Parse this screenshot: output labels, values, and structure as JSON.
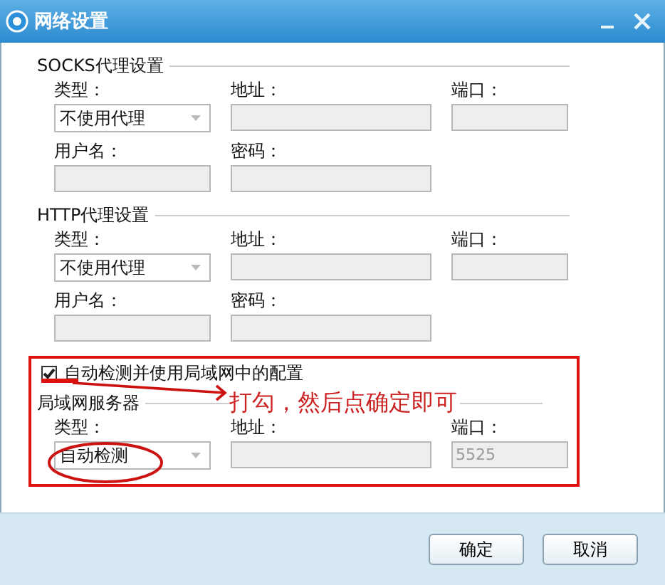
{
  "window": {
    "title": "网络设置"
  },
  "proxies": [
    {
      "title": "SOCKS代理设置",
      "type_label": "类型：",
      "type_value": "不使用代理",
      "address_label": "地址：",
      "port_label": "端口：",
      "username_label": "用户名：",
      "password_label": "密码："
    },
    {
      "title": "HTTP代理设置",
      "type_label": "类型：",
      "type_value": "不使用代理",
      "address_label": "地址：",
      "port_label": "端口：",
      "username_label": "用户名：",
      "password_label": "密码："
    }
  ],
  "lan": {
    "checkbox": {
      "label": "自动检测并使用局域网中的配置",
      "checked": true
    },
    "title": "局域网服务器",
    "type_label": "类型：",
    "type_value": "自动检测",
    "address_label": "地址：",
    "port_label": "端口：",
    "port_value": "5525"
  },
  "annotation": {
    "text": "打勾，然后点确定即可"
  },
  "buttons": [
    "确定",
    "取消"
  ]
}
